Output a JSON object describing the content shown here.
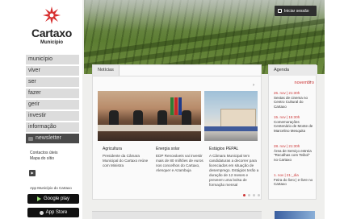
{
  "site": {
    "name": "Cartaxo",
    "subtitle": "Município"
  },
  "header": {
    "login_label": "Iniciar sessão"
  },
  "menu": [
    "município",
    "viver",
    "ser",
    "fazer",
    "gerir",
    "investir",
    "informação",
    "newsletter"
  ],
  "side_links": [
    "Contactos úteis",
    "Mapa do sítio"
  ],
  "apps": {
    "title": "App Município do Cartaxo",
    "google_label": "Google play",
    "apple_label": "App Store"
  },
  "news": {
    "tab_label": "Notícias",
    "items": [
      {
        "title": "Agricultura",
        "text": "Presidente da Câmara Municipal do Cartaxo reúne com Ministra"
      },
      {
        "title": "Energia solar",
        "text": "EDP Renováveis vai investir mais de 80 milhões de euros nos concelhos do Cartaxo, Alenquer e Azambuja"
      },
      {
        "title": "Estágios PEPAL",
        "text": "A Câmara Municipal tem candidaturas a decorrer para licenciados em situação de desemprego. Estágios terão a duração de 12 meses e preveem uma bolsa de formação mensal"
      }
    ]
  },
  "agenda": {
    "tab_label": "Agenda",
    "month": "novembro",
    "events": [
      {
        "date": "26. nov | 21:30h",
        "text": "Sextas de cinema no Centro Cultural do Cartaxo"
      },
      {
        "date": "15. nov | 15:30h",
        "text": "Comemorações Centenário de Monte de Marcelino Mesquita"
      },
      {
        "date": "28. nov | 21:30h",
        "text": "Área de Serviço estreia \"Recalhas com Teibol\" no Cartaxo"
      },
      {
        "date": "1. nov | 21:_dia",
        "text": "Feira do livro | e-livre no Cartaxo"
      }
    ]
  },
  "colors": {
    "accent": "#cc3333",
    "menu_bg": "#dcdcdc",
    "dark": "#2e2e2e"
  }
}
